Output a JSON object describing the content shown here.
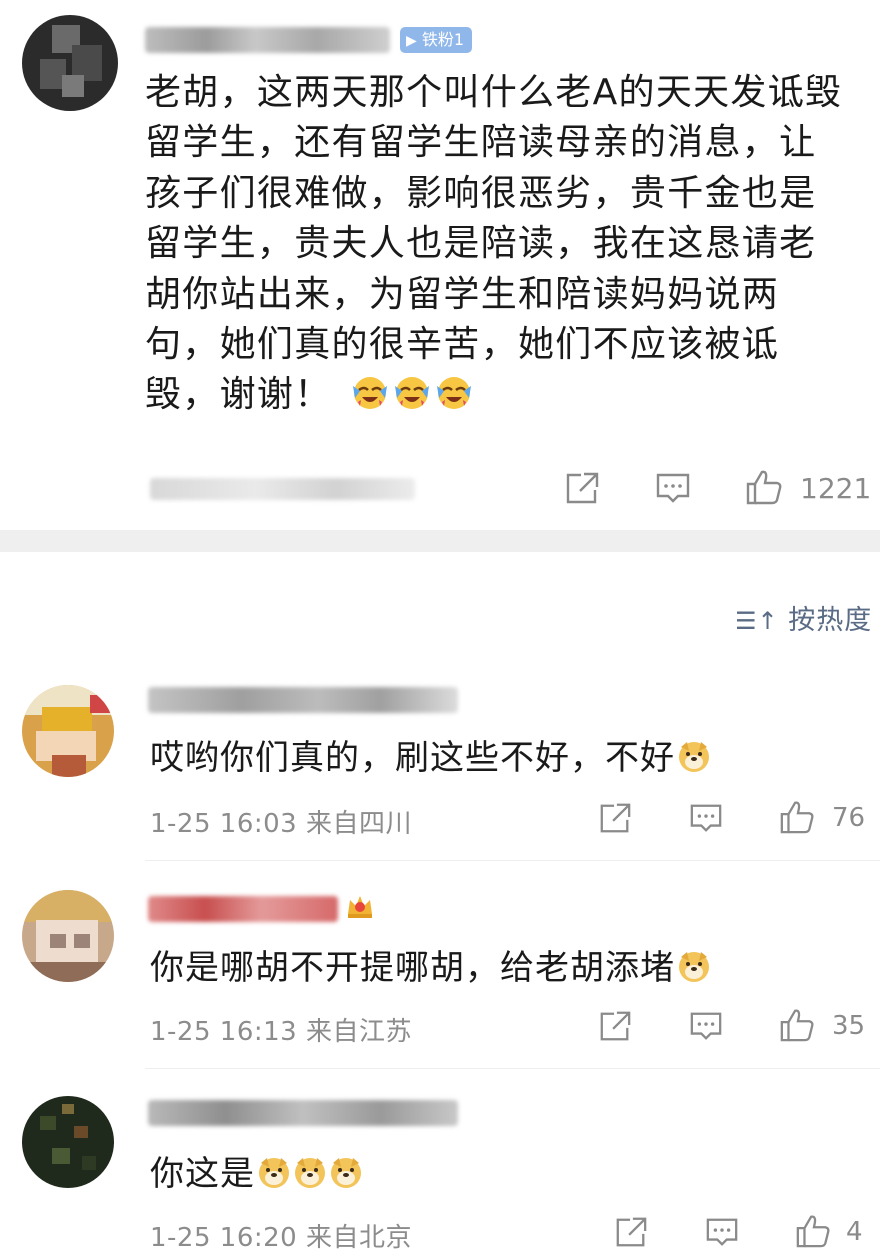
{
  "post": {
    "badge": "铁粉1",
    "text": "老胡，这两天那个叫什么老A的天天发诋毁留学生，还有留学生陪读母亲的消息，让孩子们很难做，影响很恶劣，贵千金也是留学生，贵夫人也是陪读，我在这恳请老胡你站出来，为留学生和陪读妈妈说两句，她们真的很辛苦，她们不应该被诋毁，谢谢！",
    "emojis": [
      "laugh-cry-emoji",
      "laugh-cry-emoji",
      "laugh-cry-emoji"
    ],
    "likes": "1221"
  },
  "sort_label": "按热度",
  "replies": [
    {
      "text": "哎哟你们真的，刷这些不好，不好",
      "emoji": "doge",
      "time": "1-25 16:03",
      "location": "来自四川",
      "likes": "76"
    },
    {
      "text": "你是哪胡不开提哪胡，给老胡添堵",
      "emoji": "doge",
      "time": "1-25 16:13",
      "location": "来自江苏",
      "likes": "35"
    },
    {
      "text": "你这是",
      "emoji": "doge x3",
      "time": "1-25 16:20",
      "location": "来自北京",
      "likes": "4"
    }
  ],
  "colors": {
    "accent": "#5a6b85",
    "fan_badge": "#8fb7ea",
    "meta": "#8c8c8c"
  }
}
